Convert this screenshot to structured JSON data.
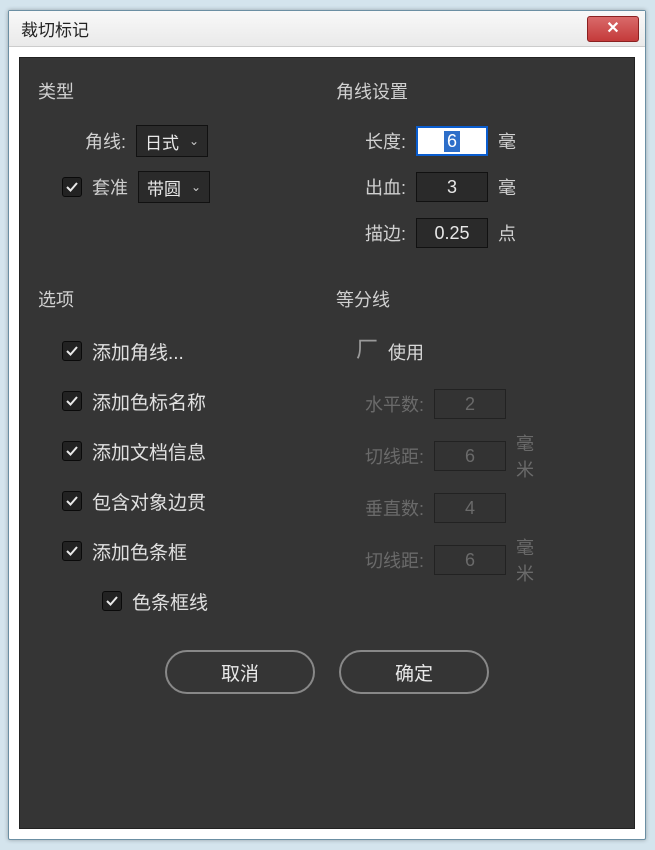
{
  "window": {
    "title": "裁切标记"
  },
  "type_group": {
    "title": "类型",
    "corner_label": "角线:",
    "corner_value": "日式",
    "register_label": "套准",
    "register_value": "带圆",
    "register_checked": true
  },
  "corner_settings": {
    "title": "角线设置",
    "length_label": "长度:",
    "length_value": "6",
    "length_unit": "毫",
    "bleed_label": "出血:",
    "bleed_value": "3",
    "bleed_unit": "毫",
    "stroke_label": "描边:",
    "stroke_value": "0.25",
    "stroke_unit": "点"
  },
  "options": {
    "title": "选项",
    "items": [
      {
        "label": "添加角线...",
        "checked": true
      },
      {
        "label": "添加色标名称",
        "checked": true
      },
      {
        "label": "添加文档信息",
        "checked": true
      },
      {
        "label": "包含对象边贯",
        "checked": true
      },
      {
        "label": "添加色条框",
        "checked": true
      },
      {
        "label": "色条框线",
        "checked": true,
        "indent": true
      }
    ]
  },
  "divider": {
    "title": "等分线",
    "use_label": "使用",
    "use_checked": false,
    "hcount_label": "水平数:",
    "hcount_value": "2",
    "hgap_label": "切线距:",
    "hgap_value": "6",
    "hgap_unit": "毫米",
    "vcount_label": "垂直数:",
    "vcount_value": "4",
    "vgap_label": "切线距:",
    "vgap_value": "6",
    "vgap_unit": "毫米"
  },
  "buttons": {
    "cancel": "取消",
    "ok": "确定"
  }
}
